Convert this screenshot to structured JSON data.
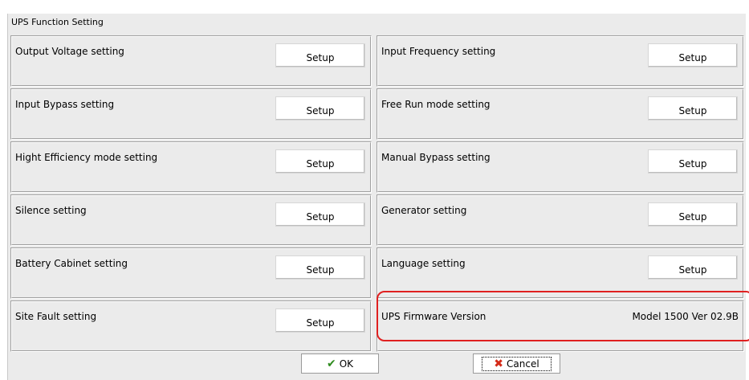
{
  "window": {
    "title": "UPS Function Setting"
  },
  "settings": [
    {
      "label": "Output Voltage setting",
      "button": "Setup"
    },
    {
      "label": "Input Frequency setting",
      "button": "Setup"
    },
    {
      "label": "Input Bypass setting",
      "button": "Setup"
    },
    {
      "label": "Free Run mode setting",
      "button": "Setup"
    },
    {
      "label": "Hight Efficiency mode setting",
      "button": "Setup"
    },
    {
      "label": "Manual Bypass setting",
      "button": "Setup"
    },
    {
      "label": "Silence setting",
      "button": "Setup"
    },
    {
      "label": "Generator setting",
      "button": "Setup"
    },
    {
      "label": "Battery Cabinet setting",
      "button": "Setup"
    },
    {
      "label": "Language setting",
      "button": "Setup"
    },
    {
      "label": "Site Fault setting",
      "button": "Setup"
    }
  ],
  "firmware": {
    "label": "UPS Firmware Version",
    "value": "Model 1500  Ver 02.9B"
  },
  "footer": {
    "ok_label": "OK",
    "cancel_label": "Cancel"
  },
  "colors": {
    "highlight": "#e02020",
    "ok_icon": "#2e8b1e",
    "cancel_icon": "#d42a18"
  }
}
